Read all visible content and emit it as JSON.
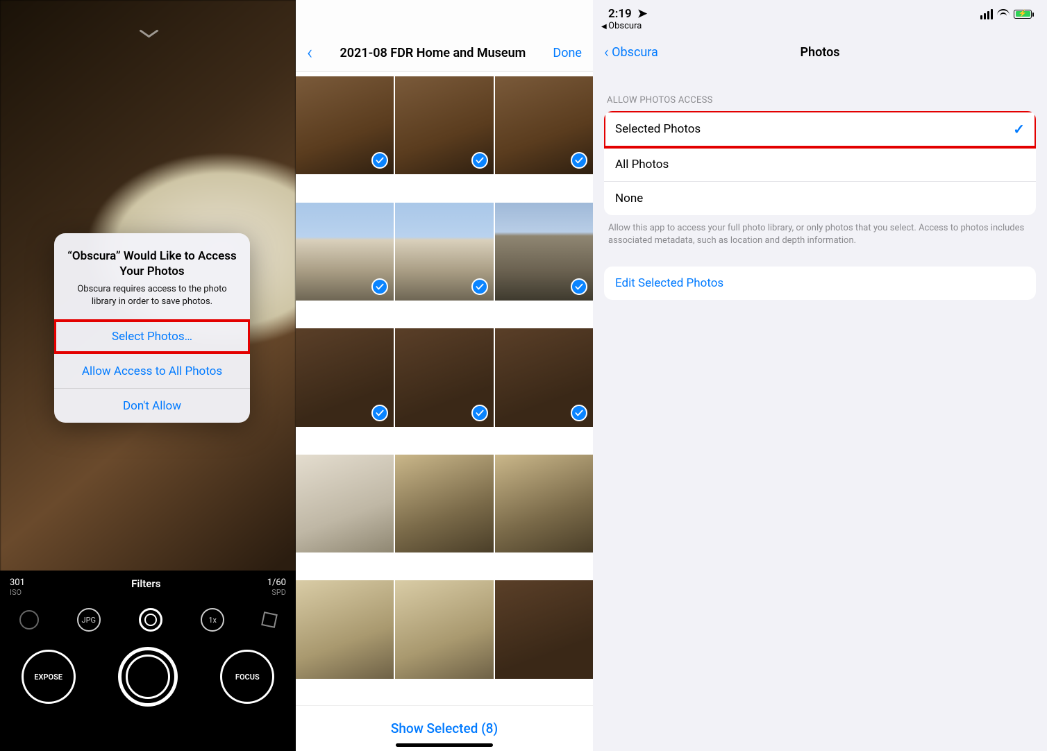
{
  "phone1": {
    "alert": {
      "title": "“Obscura” Would Like to Access Your Photos",
      "message": "Obscura requires access to the photo library in order to save photos.",
      "select": "Select Photos…",
      "allow_all": "Allow Access to All Photos",
      "deny": "Don't Allow"
    },
    "hud": {
      "iso_value": "301",
      "iso_label": "ISO",
      "filters": "Filters",
      "speed_value": "1/60",
      "speed_label": "SPD",
      "jpg": "JPG",
      "zoom": "1x",
      "expose": "EXPOSE",
      "focus": "FOCUS"
    }
  },
  "phone2": {
    "title": "2021-08 FDR Home and Museum",
    "done": "Done",
    "show_selected": "Show Selected (8)",
    "thumbs": [
      {
        "cls": "g-bronze",
        "selected": true
      },
      {
        "cls": "g-bronze",
        "selected": true
      },
      {
        "cls": "g-bronze",
        "selected": true
      },
      {
        "cls": "g-house",
        "selected": true
      },
      {
        "cls": "g-house",
        "selected": true
      },
      {
        "cls": "g-stone",
        "selected": true
      },
      {
        "cls": "g-wood",
        "selected": true
      },
      {
        "cls": "g-wood",
        "selected": true
      },
      {
        "cls": "g-wood",
        "selected": true
      },
      {
        "cls": "g-frames",
        "selected": false
      },
      {
        "cls": "g-room",
        "selected": false
      },
      {
        "cls": "g-room",
        "selected": false
      },
      {
        "cls": "g-parlor",
        "selected": false
      },
      {
        "cls": "g-parlor",
        "selected": false
      },
      {
        "cls": "g-wood",
        "selected": false
      }
    ]
  },
  "phone3": {
    "time": "2:19",
    "breadcrumb": "Obscura",
    "nav_back": "Obscura",
    "nav_title": "Photos",
    "section_header": "Allow Photos Access",
    "rows": {
      "selected": "Selected Photos",
      "all": "All Photos",
      "none": "None"
    },
    "footer": "Allow this app to access your full photo library, or only photos that you select. Access to photos includes associated metadata, such as location and depth information.",
    "edit": "Edit Selected Photos"
  }
}
